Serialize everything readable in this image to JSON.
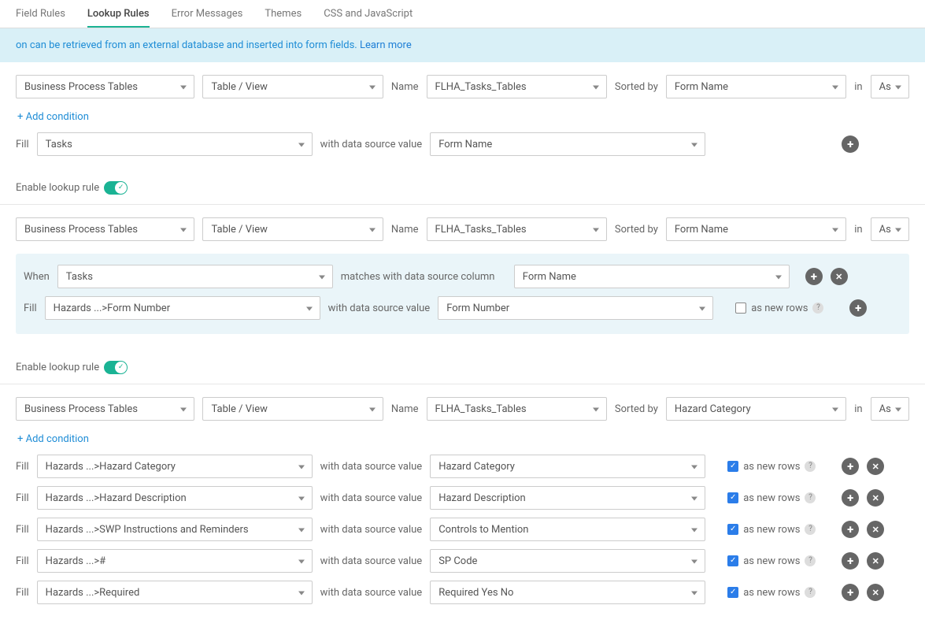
{
  "tabs": [
    "Field Rules",
    "Lookup Rules",
    "Error Messages",
    "Themes",
    "CSS and JavaScript"
  ],
  "active_tab": 1,
  "banner": {
    "text_prefix": "on can be retrieved from an external database and inserted into form fields. ",
    "link": "Learn more"
  },
  "common": {
    "name_label": "Name",
    "sorted_label": "Sorted by",
    "in_label": "in",
    "in_value": "As",
    "fill_label": "Fill",
    "with_label": "with data source value",
    "when_label": "When",
    "matches_label": "matches with data source column",
    "as_new_rows": "as new rows",
    "add_condition": "+ Add condition",
    "enable_label": "Enable lookup rule"
  },
  "rules": [
    {
      "source": "Business Process Tables",
      "tableview": "Table / View",
      "name": "FLHA_Tasks_Tables",
      "sorted_by": "Form Name",
      "show_add_condition": true,
      "has_condition_box": false,
      "fills": [
        {
          "field": "Tasks",
          "value": "Form Name",
          "show_new_rows": false,
          "new_rows_checked": false,
          "show_remove": false
        }
      ]
    },
    {
      "source": "Business Process Tables",
      "tableview": "Table / View",
      "name": "FLHA_Tasks_Tables",
      "sorted_by": "Form Name",
      "show_add_condition": false,
      "has_condition_box": true,
      "condition": {
        "when_field": "Tasks",
        "match_col": "Form Name"
      },
      "fills": [
        {
          "field": "Hazards ...>Form Number",
          "value": "Form Number",
          "show_new_rows": true,
          "new_rows_checked": false,
          "show_remove": false
        }
      ]
    },
    {
      "source": "Business Process Tables",
      "tableview": "Table / View",
      "name": "FLHA_Tasks_Tables",
      "sorted_by": "Hazard Category",
      "show_add_condition": true,
      "has_condition_box": false,
      "fills": [
        {
          "field": "Hazards ...>Hazard Category",
          "value": "Hazard Category",
          "show_new_rows": true,
          "new_rows_checked": true,
          "show_remove": true
        },
        {
          "field": "Hazards ...>Hazard Description",
          "value": "Hazard Description",
          "show_new_rows": true,
          "new_rows_checked": true,
          "show_remove": true
        },
        {
          "field": "Hazards ...>SWP Instructions and Reminders",
          "value": "Controls to Mention",
          "show_new_rows": true,
          "new_rows_checked": true,
          "show_remove": true
        },
        {
          "field": "Hazards ...>#",
          "value": "SP Code",
          "show_new_rows": true,
          "new_rows_checked": true,
          "show_remove": true
        },
        {
          "field": "Hazards ...>Required",
          "value": "Required Yes No",
          "show_new_rows": true,
          "new_rows_checked": true,
          "show_remove": true
        }
      ]
    }
  ]
}
